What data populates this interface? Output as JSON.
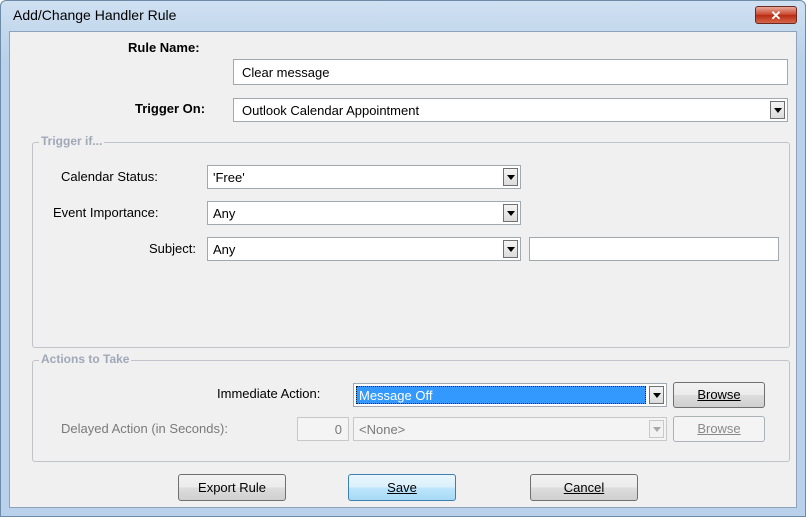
{
  "window": {
    "title": "Add/Change Handler Rule",
    "close_glyph": "✕"
  },
  "rule_name": {
    "label": "Rule Name:",
    "value": "Clear message"
  },
  "trigger_on": {
    "label": "Trigger On:",
    "value": "Outlook Calendar Appointment"
  },
  "trigger_if": {
    "legend": "Trigger if...",
    "calendar_status": {
      "label": "Calendar Status:",
      "value": "'Free'"
    },
    "event_importance": {
      "label": "Event Importance:",
      "value": "Any"
    },
    "subject": {
      "label": "Subject:",
      "value": "Any",
      "text_value": ""
    }
  },
  "actions": {
    "legend": "Actions to Take",
    "immediate": {
      "label": "Immediate Action:",
      "value": "Message Off",
      "browse_label": "Browse"
    },
    "delayed": {
      "label": "Delayed Action (in Seconds):",
      "seconds": "0",
      "value": "<None>",
      "browse_label": "Browse"
    }
  },
  "buttons": {
    "export": "Export Rule",
    "save": "Save",
    "cancel": "Cancel"
  },
  "colors": {
    "selection": "#3399ff",
    "legend_text": "#a0a8b8",
    "close_red": "#c7432a"
  }
}
